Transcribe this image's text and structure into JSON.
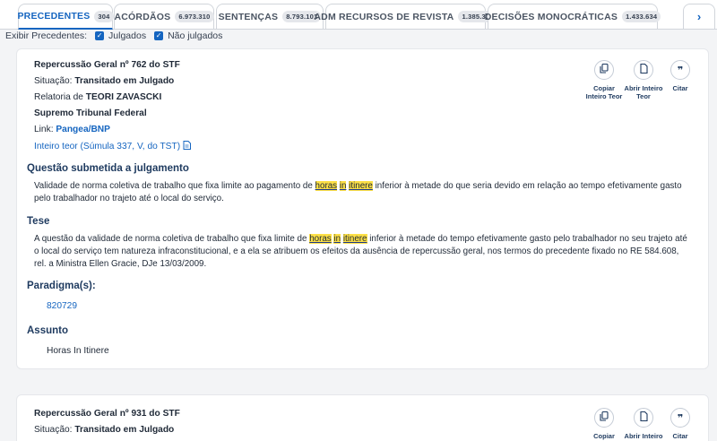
{
  "tabs": [
    {
      "label": "PRECEDENTES",
      "count": "304",
      "active": true
    },
    {
      "label": "ACÓRDÃOS",
      "count": "6.973.310"
    },
    {
      "label": "SENTENÇAS",
      "count": "8.793.101"
    },
    {
      "label": "ADM RECURSOS DE REVISTA",
      "count": "1.385.306"
    },
    {
      "label": "DECISÕES MONOCRÁTICAS",
      "count": "1.433.634"
    }
  ],
  "filter": {
    "label": "Exibir Precedentes:",
    "opt1": "Julgados",
    "opt2": "Não julgados"
  },
  "card1": {
    "title": "Repercussão Geral nº 762 do STF",
    "situacao_label": "Situação:",
    "situacao_value": "Transitado em Julgado",
    "relatoria_label": "Relatoria de",
    "relatoria_value": "TEORI ZAVASCKI",
    "court": "Supremo Tribunal Federal",
    "link_label": "Link:",
    "link_value": "Pangea/BNP",
    "inteiro_teor": "Inteiro teor (Súmula 337, V, do TST)",
    "questao_title": "Questão submetida a julgamento",
    "questao_pre": "Validade de norma coletiva de trabalho que fixa limite ao pagamento de",
    "hl_horas": "horas",
    "hl_in": "in",
    "hl_itinere": "itinere",
    "questao_post": "inferior à metade do que seria devido em relação ao tempo efetivamente gasto pelo trabalhador no trajeto até o local do serviço.",
    "tese_title": "Tese",
    "tese_pre": "A questão da validade de norma coletiva de trabalho que fixa limite de",
    "tese_post": "inferior à metade do tempo efetivamente gasto pelo trabalhador no seu trajeto até o local do serviço tem natureza infraconstitucional, e a ela se atribuem os efeitos da ausência de repercussão geral, nos termos do precedente fixado no RE 584.608, rel. a Ministra Ellen Gracie, DJe 13/03/2009.",
    "paradigma_title": "Paradigma(s):",
    "paradigma_value": "820729",
    "assunto_title": "Assunto",
    "assunto_value": "Horas In Itinere"
  },
  "actions": {
    "copy_line1": "Copiar",
    "copy_line2": "Inteiro Teor",
    "open_line1": "Abrir Inteiro",
    "open_line2": "Teor",
    "cite": "Citar"
  },
  "card2": {
    "title": "Repercussão Geral nº 931 do STF",
    "situacao_label": "Situação:",
    "situacao_value": "Transitado em Julgado",
    "copy_line1": "Copiar",
    "open_line1": "Abrir Inteiro",
    "cite": "Citar"
  },
  "icons": {
    "next": "chevron-right-icon",
    "copy": "copy-icon",
    "doc": "document-icon",
    "quote": "quote-icon",
    "pdf": "pdf-icon"
  },
  "colors": {
    "accent": "#1565c0",
    "highlight": "#fde047",
    "heading": "#1e3a5f"
  }
}
